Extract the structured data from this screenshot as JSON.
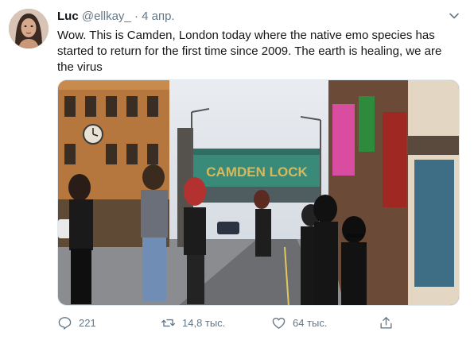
{
  "tweet": {
    "author_name": "Luc",
    "author_handle": "@ellkay_",
    "separator": "·",
    "date": "4 апр.",
    "text": "Wow. This is Camden, London today where the native emo species has started to return for the first time since 2009. The earth is healing, we are the virus",
    "image_sign_text": "CAMDEN LOCK"
  },
  "actions": {
    "replies": "221",
    "retweets": "14,8 тыс.",
    "likes": "64 тыс."
  },
  "icons": {
    "reply": "reply-icon",
    "retweet": "retweet-icon",
    "like": "heart-icon",
    "share": "share-icon",
    "menu": "chevron-down-icon"
  },
  "colors": {
    "secondary_text": "#657786",
    "border": "#e1e8ed",
    "bridge_sign": "#3a8a7a"
  }
}
